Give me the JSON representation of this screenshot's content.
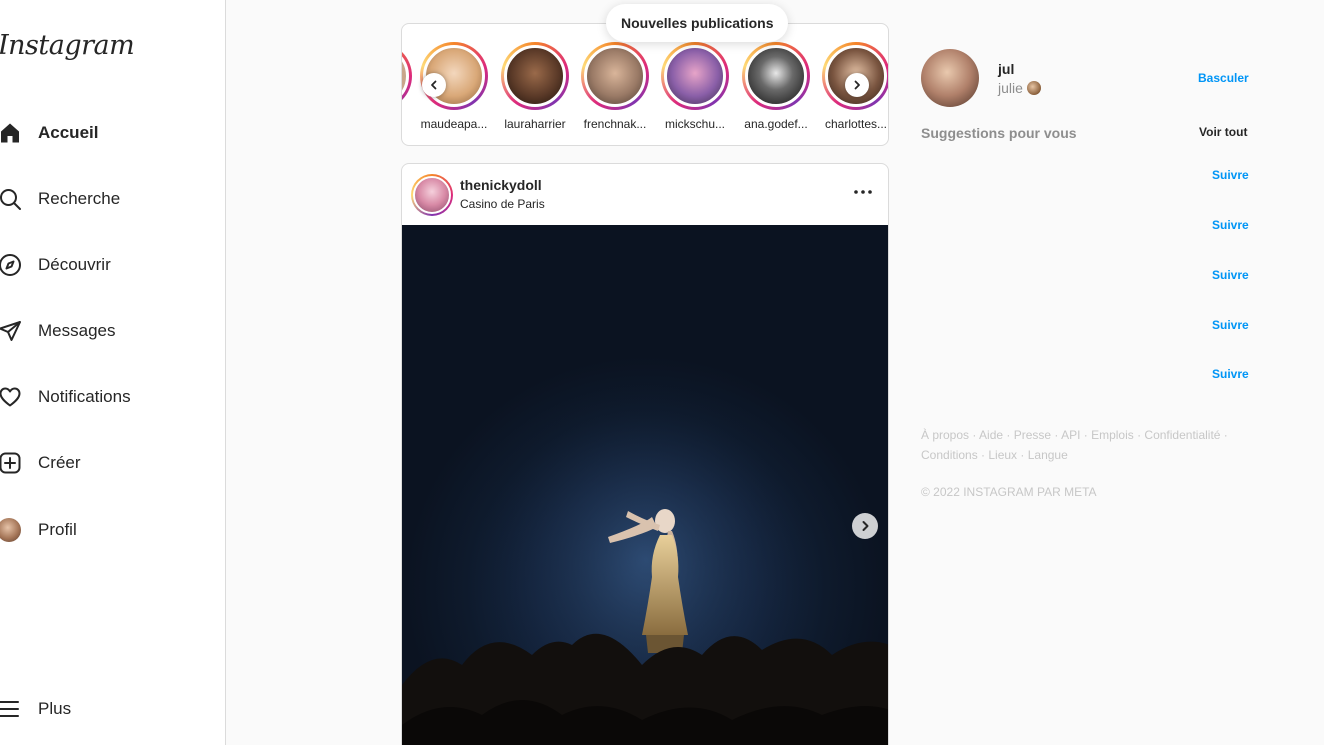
{
  "app": {
    "logo_text": "Instagram"
  },
  "sidebar": {
    "items": [
      {
        "label": "Accueil",
        "icon": "home-icon",
        "active": true
      },
      {
        "label": "Recherche",
        "icon": "search-icon"
      },
      {
        "label": "Découvrir",
        "icon": "compass-icon"
      },
      {
        "label": "Messages",
        "icon": "paper-plane-icon"
      },
      {
        "label": "Notifications",
        "icon": "heart-icon"
      },
      {
        "label": "Créer",
        "icon": "plus-square-icon"
      },
      {
        "label": "Profil",
        "icon": "avatar"
      }
    ],
    "more_label": "Plus"
  },
  "new_posts_pill": "Nouvelles publications",
  "stories": [
    {
      "username": "maudeapa...",
      "color": "#e8c7a4"
    },
    {
      "username": "lauraharrier",
      "color": "#6b4a36"
    },
    {
      "username": "frenchnak...",
      "color": "#9a7a66"
    },
    {
      "username": "mickschu...",
      "color": "#8a5fa8"
    },
    {
      "username": "ana.godef...",
      "color": "#2b2b2b"
    },
    {
      "username": "charlottes...",
      "color": "#7a5540"
    }
  ],
  "post": {
    "username": "thenickydoll",
    "location": "Casino de Paris"
  },
  "current_user": {
    "username": "jul",
    "name": "julie",
    "switch_label": "Basculer"
  },
  "suggestions": {
    "title": "Suggestions pour vous",
    "see_all_label": "Voir tout",
    "items": [
      {
        "follow_label": "Suivre"
      },
      {
        "follow_label": "Suivre"
      },
      {
        "follow_label": "Suivre"
      },
      {
        "follow_label": "Suivre"
      },
      {
        "follow_label": "Suivre"
      }
    ]
  },
  "footer": {
    "links": "À propos · Aide · Presse · API · Emplois · Confidentialité · Conditions · Lieux · Langue",
    "copyright": "© 2022 INSTAGRAM PAR META"
  },
  "colors": {
    "accent": "#0095f6",
    "text": "#262626",
    "muted": "#8e8e8e"
  }
}
